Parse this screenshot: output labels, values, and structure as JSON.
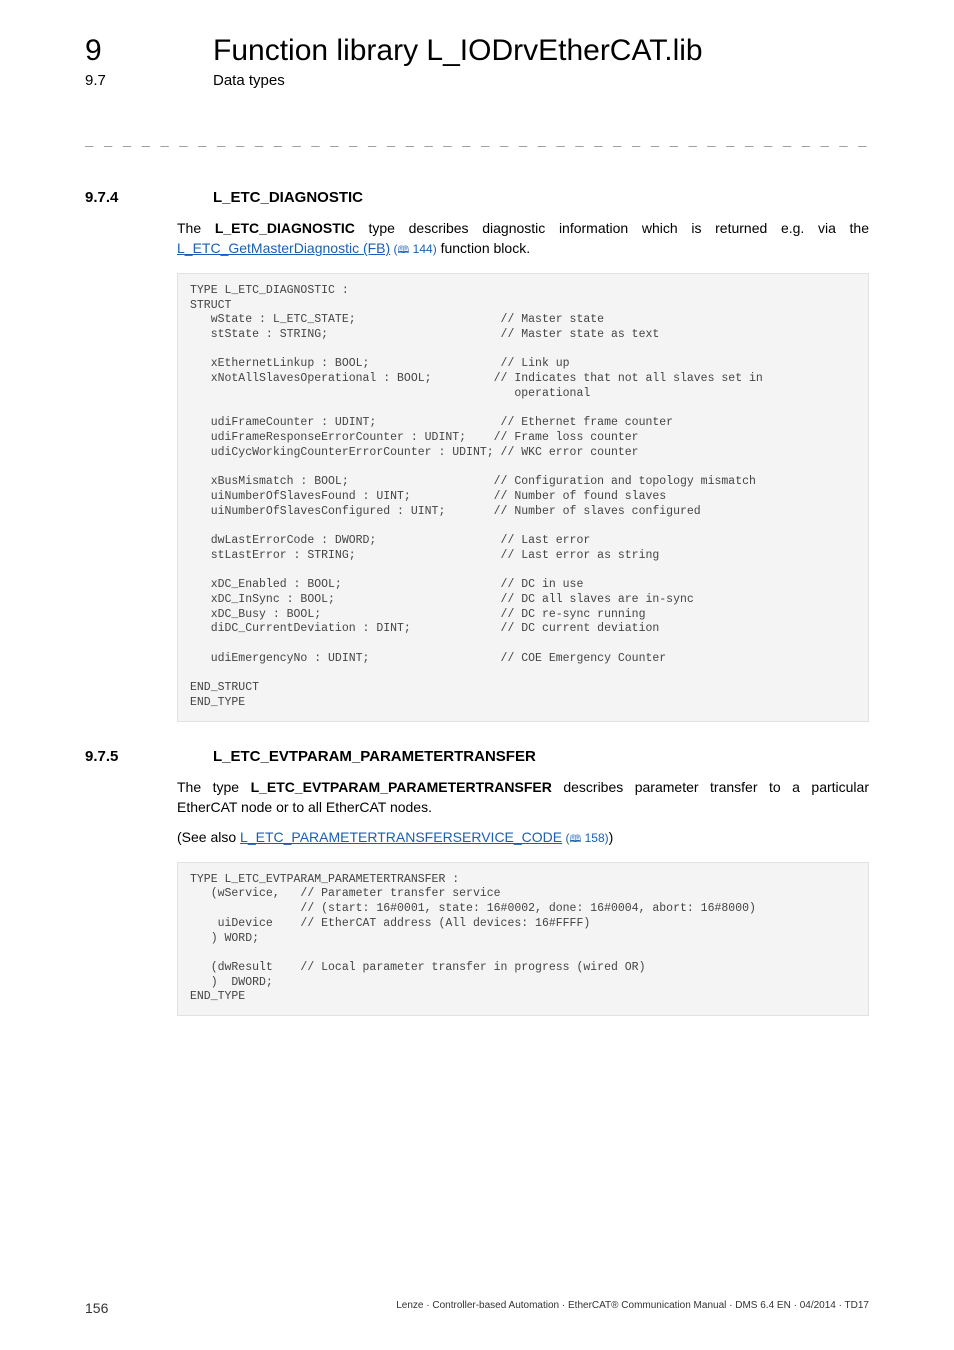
{
  "header": {
    "chapter_number": "9",
    "chapter_title": "Function library L_IODrvEtherCAT.lib",
    "section_number": "9.7",
    "section_title": "Data types"
  },
  "separator": "_ _ _ _ _ _ _ _ _ _ _ _ _ _ _ _ _ _ _ _ _ _ _ _ _ _ _ _ _ _ _ _ _ _ _ _ _ _ _ _ _ _ _ _ _ _ _ _ _ _ _ _ _ _ _ _ _ _ _ _ _ _ _ _",
  "section1": {
    "number": "9.7.4",
    "title": "L_ETC_DIAGNOSTIC",
    "intro_pre": "The ",
    "intro_bold": "L_ETC_DIAGNOSTIC",
    "intro_post": " type describes diagnostic information which is returned e.g. via the ",
    "link_text": "L_ETC_GetMasterDiagnostic (FB)",
    "link_ref": "144",
    "intro_tail": " function block.",
    "code": "TYPE L_ETC_DIAGNOSTIC :\nSTRUCT\n   wState : L_ETC_STATE;                     // Master state\n   stState : STRING;                         // Master state as text\n\n   xEthernetLinkup : BOOL;                   // Link up\n   xNotAllSlavesOperational : BOOL;         // Indicates that not all slaves set in\n                                               operational\n\n   udiFrameCounter : UDINT;                  // Ethernet frame counter\n   udiFrameResponseErrorCounter : UDINT;    // Frame loss counter\n   udiCycWorkingCounterErrorCounter : UDINT; // WKC error counter\n\n   xBusMismatch : BOOL;                     // Configuration and topology mismatch\n   uiNumberOfSlavesFound : UINT;            // Number of found slaves\n   uiNumberOfSlavesConfigured : UINT;       // Number of slaves configured\n\n   dwLastErrorCode : DWORD;                  // Last error\n   stLastError : STRING;                     // Last error as string\n\n   xDC_Enabled : BOOL;                       // DC in use\n   xDC_InSync : BOOL;                        // DC all slaves are in-sync\n   xDC_Busy : BOOL;                          // DC re-sync running\n   diDC_CurrentDeviation : DINT;             // DC current deviation\n\n   udiEmergencyNo : UDINT;                   // COE Emergency Counter\n\nEND_STRUCT\nEND_TYPE"
  },
  "section2": {
    "number": "9.7.5",
    "title": "L_ETC_EVTPARAM_PARAMETERTRANSFER",
    "intro_pre": "The type ",
    "intro_bold": "L_ETC_EVTPARAM_PARAMETERTRANSFER",
    "intro_post": " describes parameter transfer to a particular EtherCAT node or to all EtherCAT nodes.",
    "see_also_pre": "(See also ",
    "see_also_link": "L_ETC_PARAMETERTRANSFERSERVICE_CODE",
    "see_also_ref": "158",
    "see_also_post": ")",
    "code": "TYPE L_ETC_EVTPARAM_PARAMETERTRANSFER :\n   (wService,   // Parameter transfer service\n                // (start: 16#0001, state: 16#0002, done: 16#0004, abort: 16#8000)\n    uiDevice    // EtherCAT address (All devices: 16#FFFF)\n   ) WORD;\n\n   (dwResult    // Local parameter transfer in progress (wired OR)\n   )  DWORD;\nEND_TYPE"
  },
  "footer": {
    "page_number": "156",
    "doc_info": "Lenze · Controller-based Automation · EtherCAT® Communication Manual · DMS 6.4 EN · 04/2014 · TD17"
  }
}
